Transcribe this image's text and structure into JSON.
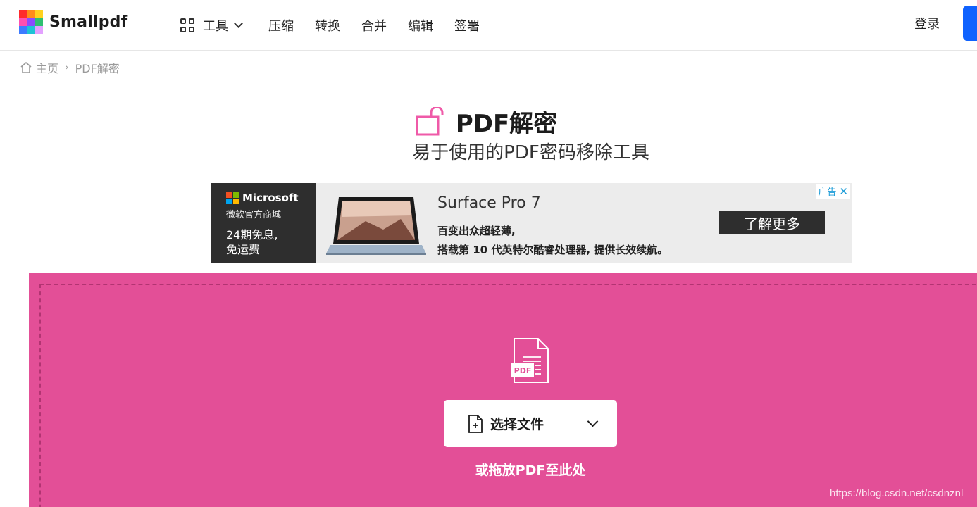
{
  "header": {
    "brand": "Smallpdf",
    "tools_label": "工具",
    "nav": [
      "压缩",
      "转换",
      "合并",
      "编辑",
      "签署"
    ],
    "login": "登录",
    "logo_colors": [
      "#ff2b2b",
      "#ff8c1a",
      "#ffd21f",
      "#2fbf71",
      "#1ec3d6",
      "#3d7bff",
      "#8a4bff",
      "#ff4fb0",
      "#e3a1ff"
    ]
  },
  "breadcrumb": {
    "home": "主页",
    "separator": "›",
    "current": "PDF解密"
  },
  "hero": {
    "title": "PDF解密",
    "subtitle": "易于使用的PDF密码移除工具"
  },
  "ad": {
    "brand": "Microsoft",
    "store": "微软官方商城",
    "offer_line1": "24期免息,",
    "offer_line2": "免运费",
    "product": "Surface Pro 7",
    "line1": "百变出众超轻薄,",
    "line2": "搭载第 10 代英特尔酷睿处理器, 提供长效续航。",
    "button": "了解更多",
    "badge": "广告",
    "close": "✕"
  },
  "dropzone": {
    "file_badge": "PDF",
    "choose_button": "选择文件",
    "hint": "或拖放PDF至此处",
    "bg_color": "#e34f97"
  },
  "watermark": "https://blog.csdn.net/csdnznl",
  "colors": {
    "accent": "#e34f97",
    "primary_blue": "#0f62fe",
    "lock_pink": "#ef5aa8"
  }
}
